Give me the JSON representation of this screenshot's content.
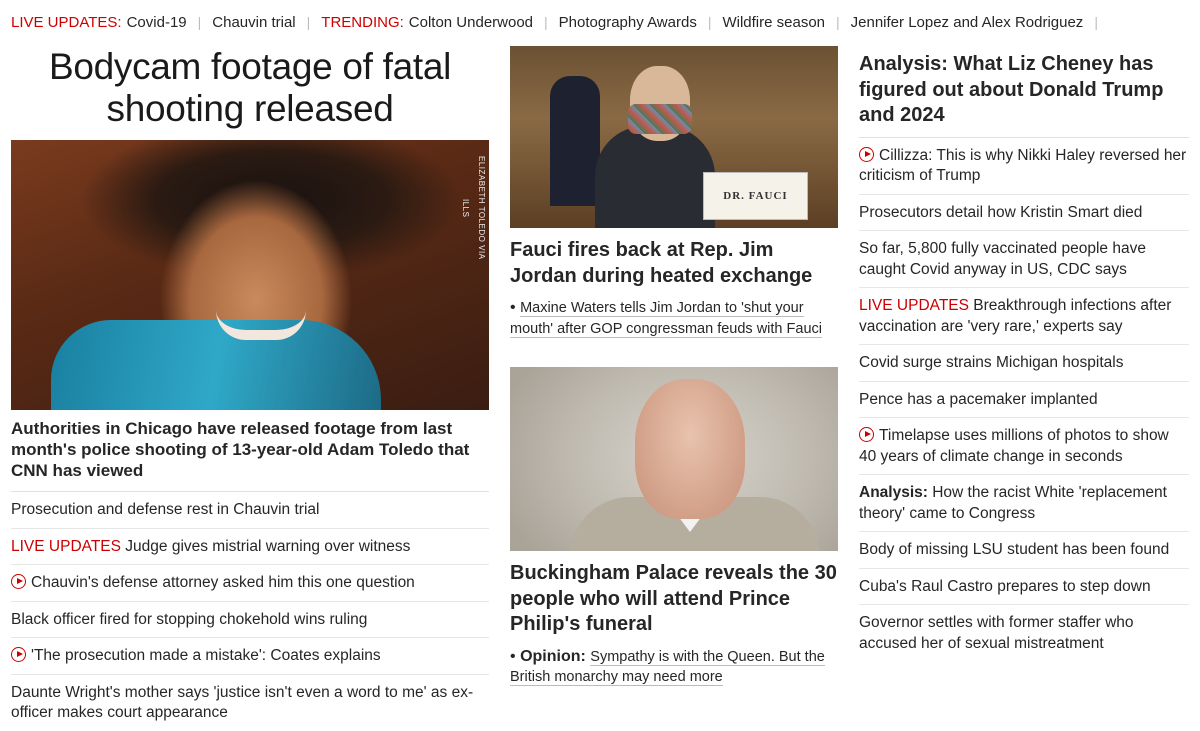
{
  "topbar": {
    "live_label": "LIVE UPDATES:",
    "live_link": "Covid-19",
    "chauvin": "Chauvin trial",
    "trending_label": "TRENDING:",
    "t1": "Colton Underwood",
    "t2": "Photography Awards",
    "t3": "Wildfire season",
    "t4": "Jennifer Lopez and Alex Rodriguez"
  },
  "left": {
    "headline": "Bodycam footage of fatal shooting released",
    "photo_credit": "ELIZABETH TOLEDO VIA ILLS",
    "lead": "Authorities in Chicago have released footage from last month's police shooting of 13-year-old Adam Toledo that CNN has viewed",
    "items": [
      {
        "prefix": "",
        "text": "Prosecution and defense rest in Chauvin trial"
      },
      {
        "prefix": "LIVE UPDATES",
        "text": "Judge gives mistrial warning over witness"
      },
      {
        "prefix": "",
        "text": "Chauvin's defense attorney asked him this one question"
      },
      {
        "prefix": "",
        "text": "Black officer fired for stopping chokehold wins ruling"
      },
      {
        "prefix": "",
        "text": "'The prosecution made a mistake': Coates explains"
      },
      {
        "prefix": "",
        "text": "Daunte Wright's mother says 'justice isn't even a word to me' as ex-officer makes court appearance"
      }
    ]
  },
  "middle": {
    "fauci_card": "DR. FAUCI",
    "story1_headline": "Fauci fires back at Rep. Jim Jordan during heated exchange",
    "story1_sub": "Maxine Waters tells Jim Jordan to 'shut your mouth' after GOP congressman feuds with Fauci",
    "story2_headline": "Buckingham Palace reveals the 30 people who will attend Prince Philip's funeral",
    "story2_sub_bold": "Opinion:",
    "story2_sub": "Sympathy is with the Queen. But the British monarchy may need more"
  },
  "right": {
    "headline": "Analysis: What Liz Cheney has figured out about Donald Trump and 2024",
    "items": [
      {
        "prefix": "",
        "text": "Cillizza: This is why Nikki Haley reversed her criticism of Trump"
      },
      {
        "prefix": "",
        "text": "Prosecutors detail how Kristin Smart died"
      },
      {
        "prefix": "",
        "text": "So far, 5,800 fully vaccinated people have caught Covid anyway in US, CDC says"
      },
      {
        "prefix": "LIVE UPDATES",
        "text": "Breakthrough infections after vaccination are 'very rare,' experts say"
      },
      {
        "prefix": "",
        "text": "Covid surge strains Michigan hospitals"
      },
      {
        "prefix": "",
        "text": "Pence has a pacemaker implanted"
      },
      {
        "prefix": "",
        "text": "Timelapse uses millions of photos to show 40 years of climate change in seconds"
      },
      {
        "prefix": "Analysis:",
        "text": "How the racist White 'replacement theory' came to Congress"
      },
      {
        "prefix": "",
        "text": "Body of missing LSU student has been found"
      },
      {
        "prefix": "",
        "text": "Cuba's Raul Castro prepares to step down"
      },
      {
        "prefix": "",
        "text": "Governor settles with former staffer who accused her of sexual mistreatment"
      }
    ]
  },
  "colors": {
    "accent": "#cc0000",
    "text": "#262626",
    "divider": "#e6e6e6"
  }
}
